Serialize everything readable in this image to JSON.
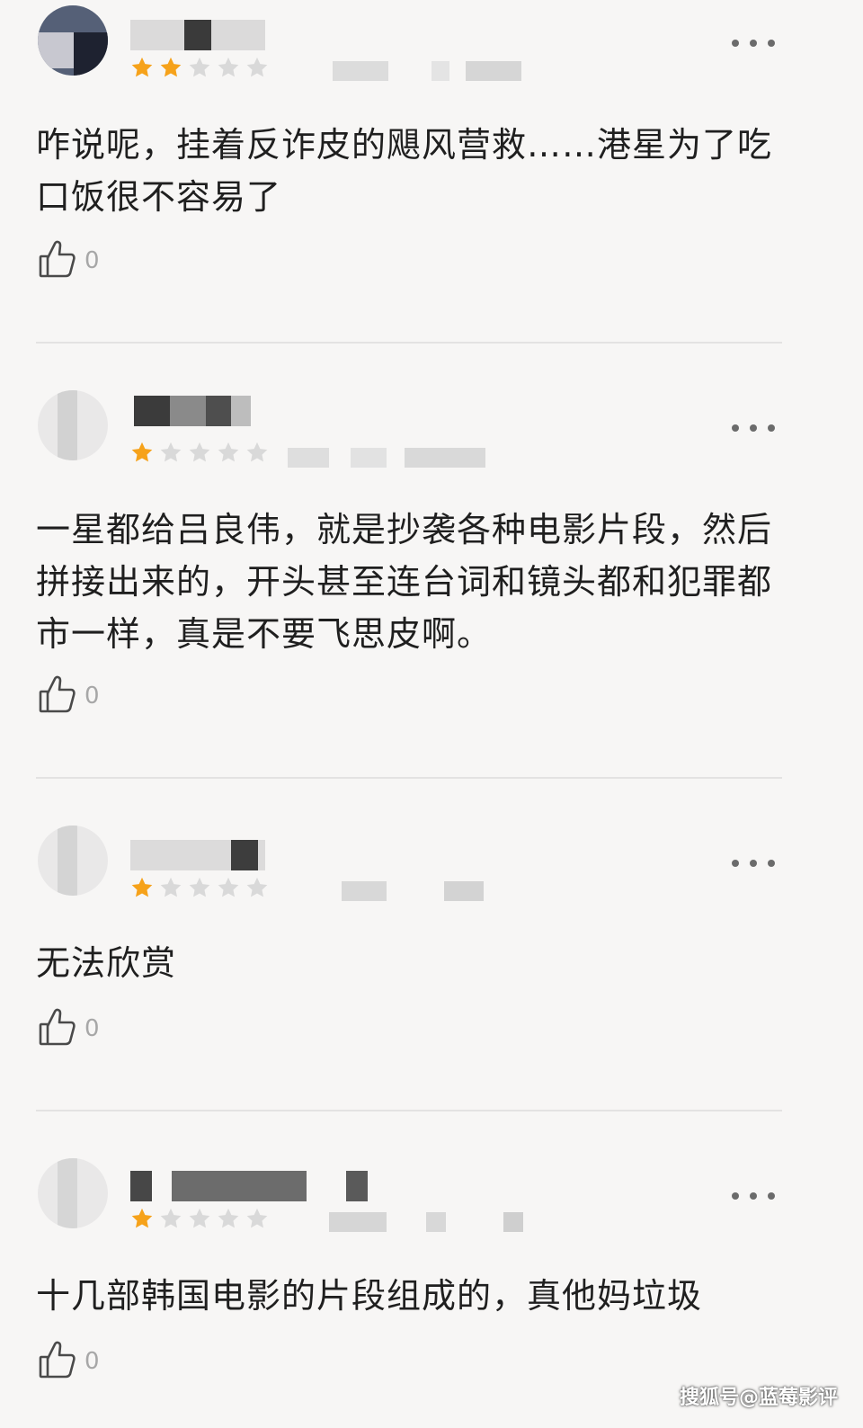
{
  "reviews": [
    {
      "rating": 2,
      "text": "咋说呢，挂着反诈皮的飓风营救……港星为了吃口饭很不容易了",
      "likes": "0"
    },
    {
      "rating": 1,
      "text": "一星都给吕良伟，就是抄袭各种电影片段，然后拼接出来的，开头甚至连台词和镜头都和犯罪都市一样，真是不要飞思皮啊。",
      "likes": "0"
    },
    {
      "rating": 1,
      "text": "无法欣赏",
      "likes": "0"
    },
    {
      "rating": 1,
      "text": "十几部韩国电影的片段组成的，真他妈垃圾",
      "likes": "0"
    }
  ],
  "max_rating": 5,
  "colors": {
    "star_on": "#f6a21a",
    "star_off": "#d9d9d9",
    "text": "#1f1f1f",
    "muted": "#a7a7a7"
  },
  "icons": {
    "like": "thumbs-up-icon",
    "more": "more-dots-icon",
    "star": "star-icon"
  },
  "watermark": "搜狐号@蓝莓影评"
}
